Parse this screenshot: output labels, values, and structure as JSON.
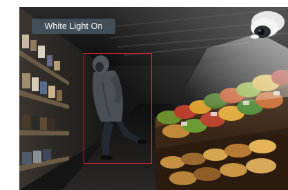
{
  "overlay": {
    "light_mode_label": "White Light On"
  },
  "colors": {
    "badge_background": "#46545f",
    "badge_text": "#ffffff",
    "detection_box": "#c8242c"
  },
  "scene": {
    "subject": "person",
    "detection_active": true
  }
}
